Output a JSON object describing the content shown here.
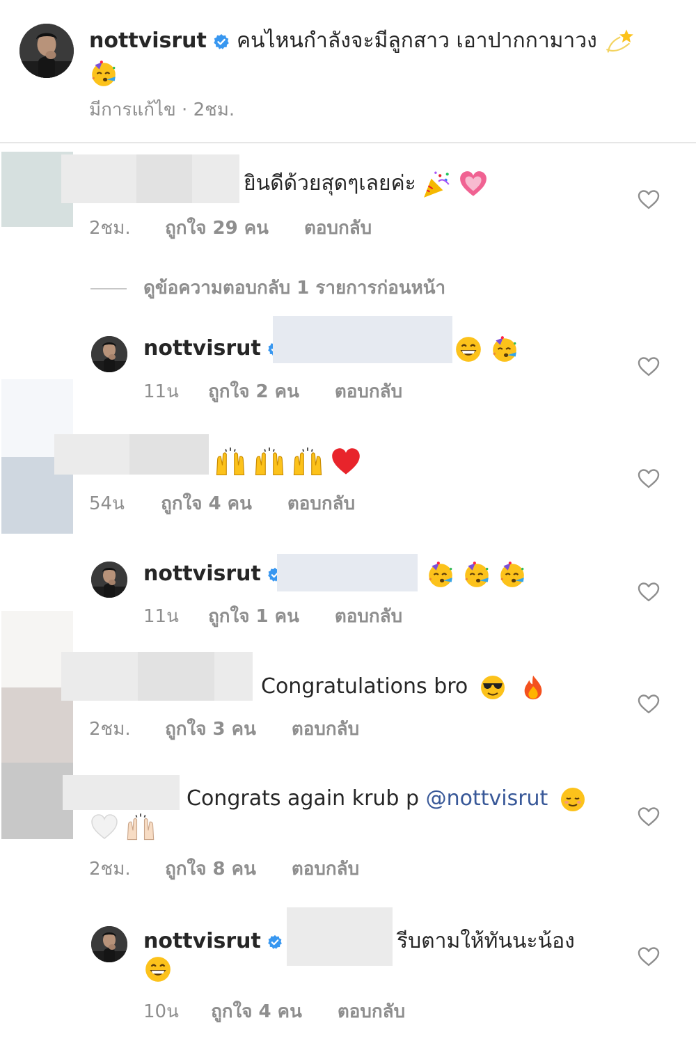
{
  "caption": {
    "username": "nottvisrut",
    "text": "คนไหนกำลังจะมีลูกสาว เอาปากกามาวง",
    "edited_label": "มีการแก้ไข",
    "time": "2ชม."
  },
  "view_replies_label": "ดูข้อความตอบกลับ 1 รายการก่อนหน้า",
  "reply_label": "ตอบกลับ",
  "colors": {
    "verified": "#3897f0",
    "meta": "#8e8e8e",
    "mention": "#385898",
    "text": "#262626"
  },
  "comments": [
    {
      "text": "ยินดีด้วยสุดๆเลยค่ะ",
      "time": "2ชม.",
      "likes": "ถูกใจ 29 คน"
    },
    {
      "username": "nottvisrut",
      "time": "11น",
      "likes": "ถูกใจ 2 คน"
    },
    {
      "time": "54น",
      "likes": "ถูกใจ 4 คน"
    },
    {
      "username": "nottvisrut",
      "time": "11น",
      "likes": "ถูกใจ 1 คน"
    },
    {
      "text": "Congratulations bro",
      "time": "2ชม.",
      "likes": "ถูกใจ 3 คน"
    },
    {
      "text": "Congrats again krub p",
      "mention": "@nottvisrut",
      "time": "2ชม.",
      "likes": "ถูกใจ 8 คน"
    },
    {
      "username": "nottvisrut",
      "text": "รีบตามให้ทันนะน้อง",
      "time": "10น",
      "likes": "ถูกใจ 4 คน"
    }
  ],
  "icons": {
    "like": "heart-outline-icon",
    "verified": "verified-badge-icon",
    "emojis": [
      "dizzy-emoji",
      "partying-face-emoji",
      "party-popper-emoji",
      "sparkling-heart-emoji",
      "grinning-face-emoji",
      "raising-hands-emoji",
      "red-heart-emoji",
      "sunglasses-face-emoji",
      "fire-emoji",
      "smiling-face-emoji",
      "white-heart-emoji"
    ]
  }
}
